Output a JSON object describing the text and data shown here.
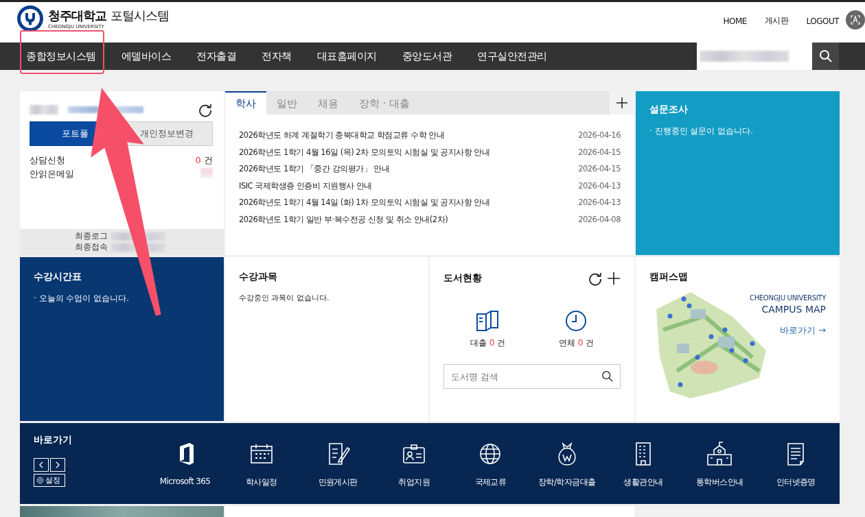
{
  "header": {
    "logo": {
      "name": "청주대학교",
      "product": "포털시스템",
      "english": "CHEONGJU UNIVERSITY"
    },
    "top_links": [
      "HOME",
      "게시판",
      "LOGOUT"
    ]
  },
  "nav": [
    {
      "label": "종합정보시스템",
      "highlighted": true
    },
    {
      "label": "에델바이스",
      "highlighted": false
    },
    {
      "label": "전자출결",
      "highlighted": false
    },
    {
      "label": "전자책",
      "highlighted": false
    },
    {
      "label": "대표홈페이지",
      "highlighted": false
    },
    {
      "label": "중앙도서관",
      "highlighted": false
    },
    {
      "label": "연구실안전관리",
      "highlighted": false
    }
  ],
  "profile": {
    "buttons": [
      {
        "label": "포트폴",
        "selected": true
      },
      {
        "label": "개인정보변경",
        "selected": false
      }
    ],
    "stats": [
      {
        "label": "상담신청",
        "count": "0",
        "unit": "건",
        "redacted": false
      },
      {
        "label": "안읽은메일",
        "redacted": true
      }
    ],
    "footer": [
      "최종로그",
      "최종접속"
    ]
  },
  "notices": {
    "tabs": [
      {
        "label": "학사",
        "selected": true
      },
      {
        "label": "일반",
        "selected": false
      },
      {
        "label": "채용",
        "selected": false
      },
      {
        "label": "장학 · 대출",
        "selected": false
      }
    ],
    "rows": [
      {
        "title": "2026학년도 하계 계절학기 충북대학교 학점교류 수학 안내",
        "date": "2026-04-16"
      },
      {
        "title": "2026학년도 1학기 4월 16일 (목) 2차 모의토익 시험실 및 공지사항 안내",
        "date": "2026-04-15"
      },
      {
        "title": "2026학년도 1학기 「중간 강의평가」 안내",
        "date": "2026-04-15"
      },
      {
        "title": "ISIC 국제학생증 인증비 지원행사 안내",
        "date": "2026-04-13"
      },
      {
        "title": "2026학년도 1학기 4월 14일 (화) 1차 모의토익 시험실 및 공지사항 안내",
        "date": "2026-04-13"
      },
      {
        "title": "2026학년도 1학기 일반 부·복수전공 신청 및 취소 안내(2차)",
        "date": "2026-04-08"
      }
    ]
  },
  "survey": {
    "title": "설문조사",
    "message": "· 진행중인 설문이 없습니다."
  },
  "timetable": {
    "title": "수강시간표",
    "message": "· 오늘의 수업이 없습니다."
  },
  "courses": {
    "title": "수강과목",
    "message": "수강중인 과목이 없습니다."
  },
  "library": {
    "title": "도서현황",
    "stats": [
      {
        "label": "대출",
        "count": "0",
        "unit": "건"
      },
      {
        "label": "연체",
        "count": "0",
        "unit": "건"
      }
    ],
    "search": {
      "placeholder": "도서명 검색"
    }
  },
  "campus_map": {
    "title": "캠퍼스맵",
    "english": "CHEONGJU UNIVERSITY",
    "heading": "CAMPUS MAP",
    "link": "바로가기 →"
  },
  "quick_links": {
    "title": "바로가기",
    "settings": "설정",
    "items": [
      {
        "label": "Microsoft 365"
      },
      {
        "label": "학사일정"
      },
      {
        "label": "민원게시판"
      },
      {
        "label": "취업지원"
      },
      {
        "label": "국제교류"
      },
      {
        "label": "장학/학자금대출"
      },
      {
        "label": "생활관안내"
      },
      {
        "label": "통학버스안내"
      },
      {
        "label": "인터넷증명"
      }
    ]
  },
  "annotation_arrow": true
}
